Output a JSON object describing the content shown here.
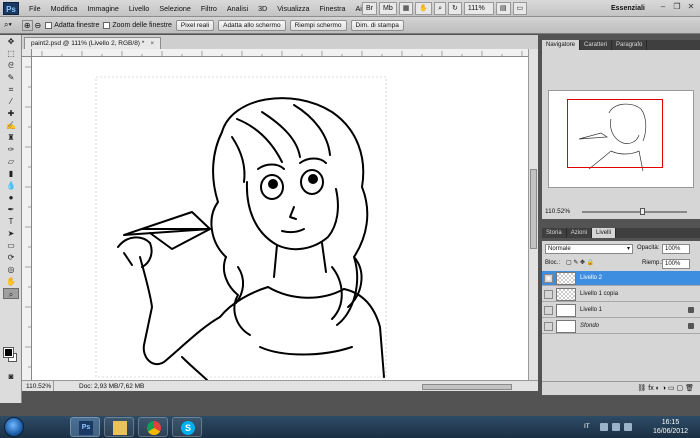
{
  "menubar": {
    "logo": "Ps",
    "items": [
      "File",
      "Modifica",
      "Immagine",
      "Livello",
      "Selezione",
      "Filtro",
      "Analisi",
      "3D",
      "Visualizza",
      "Finestra",
      "Aiuto"
    ],
    "zoom": "111%",
    "workspace": "Essenziali"
  },
  "options": {
    "adatta_finestre": "Adatta finestre",
    "zoom_finestre": "Zoom delle finestre",
    "pixel_reali": "Pixel reali",
    "adatta_schermo": "Adatta allo schermo",
    "riempi_schermo": "Riempi schermo",
    "dim_stampa": "Dim. di stampa"
  },
  "document": {
    "tab_title": "paint2.psd @ 111% (Livello 2, RGB/8) *",
    "zoom": "110.52%",
    "info": "Doc: 2,93 MB/7,62 MB"
  },
  "navigator": {
    "tabs": [
      "Navigatore",
      "Caratteri",
      "Paragrafo"
    ],
    "zoom": "110.52%"
  },
  "layers": {
    "tabs": [
      "Storia",
      "Azioni",
      "Livelli"
    ],
    "blend_mode": "Normale",
    "opacity_label": "Opacità:",
    "opacity": "100%",
    "lock_label": "Bloc.:",
    "fill_label": "Riemp.:",
    "fill": "100%",
    "items": [
      {
        "name": "Livello 2"
      },
      {
        "name": "Livello 1 copia"
      },
      {
        "name": "Livello 1"
      },
      {
        "name": "Sfondo"
      }
    ]
  },
  "taskbar": {
    "lang": "IT",
    "time": "16:15",
    "date": "16/06/2012"
  }
}
